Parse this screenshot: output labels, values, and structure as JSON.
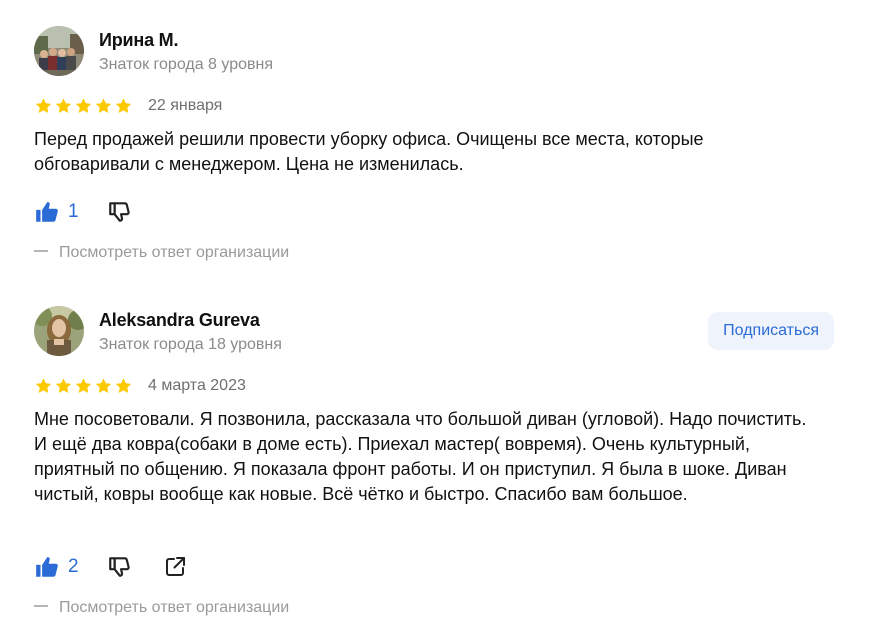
{
  "reviews": [
    {
      "author": "Ирина М.",
      "level": "Знаток города 8 уровня",
      "rating": 5,
      "date": "22 января",
      "text": "Перед продажей решили провести уборку офиса. Очищены все места, которые обговаривали с менеджером. Цена не изменилась.",
      "likes": "1",
      "org_reply_label": "Посмотреть ответ организации"
    },
    {
      "author": "Aleksandra Gureva",
      "level": "Знаток города 18 уровня",
      "subscribe_label": "Подписаться",
      "rating": 5,
      "date": "4 марта 2023",
      "text": "Мне посоветовали. Я позвонила, рассказала что большой диван (угловой). Надо почистить. И ещё два ковра(собаки в доме есть). Приехал мастер( вовремя). Очень культурный, приятный по общению. Я показала фронт работы. И он приступил. Я была в шоке. Диван чистый, ковры вообще как новые. Всё чётко и быстро. Спасибо вам большое.",
      "likes": "2",
      "org_reply_label": "Посмотреть ответ организации"
    }
  ],
  "colors": {
    "star": "#fcc800",
    "accent": "#2a6bd6",
    "muted": "#8a8a8a"
  },
  "icons": {
    "like": "thumbs-up-icon",
    "dislike": "thumbs-down-icon",
    "share": "share-icon"
  }
}
